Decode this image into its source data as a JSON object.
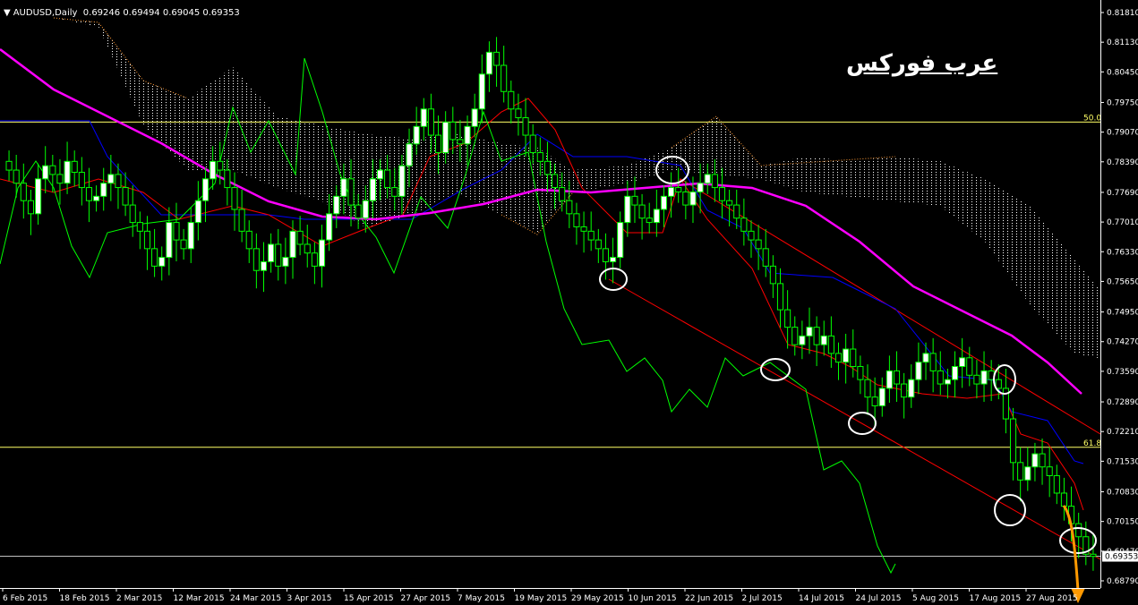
{
  "header": {
    "symbol": "AUDUSD,Daily",
    "ohlc": "0.69246 0.69494 0.69045 0.69353"
  },
  "logo_text": "عرب فوركس",
  "colors": {
    "background": "#000000",
    "bull_candle": "#ffffff",
    "candle_wick": "#00ff00",
    "tenkan": "#ff0000",
    "kijun": "#0000ff",
    "chikou": "#00ff00",
    "ma": "#ff00ff",
    "cloud": "#ffffff",
    "cloud_bear": "#ff9933",
    "fib_line": "#ffff66",
    "channel": "#ff0000",
    "circle": "#ffffff",
    "arrow": "#ff9900"
  },
  "chart_data": {
    "type": "candlestick",
    "title": "AUDUSD,Daily",
    "y_axis": {
      "min": 0.6879,
      "max": 0.8181,
      "ticks": [
        "0.81810",
        "0.81130",
        "0.80450",
        "0.79750",
        "0.79070",
        "0.78390",
        "0.77690",
        "0.77010",
        "0.76330",
        "0.75650",
        "0.74950",
        "0.74270",
        "0.73590",
        "0.72890",
        "0.72210",
        "0.71530",
        "0.70830",
        "0.70150",
        "0.69470",
        "0.68790"
      ]
    },
    "x_axis": {
      "labels": [
        "6 Feb 2015",
        "18 Feb 2015",
        "2 Mar 2015",
        "12 Mar 2015",
        "24 Mar 2015",
        "3 Apr 2015",
        "15 Apr 2015",
        "27 Apr 2015",
        "7 May 2015",
        "19 May 2015",
        "29 May 2015",
        "10 Jun 2015",
        "22 Jun 2015",
        "2 Jul 2015",
        "14 Jul 2015",
        "24 Jul 2015",
        "5 Aug 2015",
        "17 Aug 2015",
        "27 Aug 2015"
      ]
    },
    "fib_levels": [
      {
        "label": "50.0",
        "price": 0.793
      },
      {
        "label": "61.8",
        "price": 0.7185
      }
    ],
    "current_price": {
      "label": "0.69353",
      "value": 0.69353
    },
    "closes": [
      0.782,
      0.779,
      0.775,
      0.772,
      0.78,
      0.783,
      0.781,
      0.779,
      0.784,
      0.7815,
      0.778,
      0.775,
      0.776,
      0.779,
      0.781,
      0.778,
      0.774,
      0.77,
      0.768,
      0.764,
      0.76,
      0.762,
      0.77,
      0.766,
      0.764,
      0.77,
      0.775,
      0.78,
      0.784,
      0.782,
      0.778,
      0.773,
      0.768,
      0.764,
      0.759,
      0.761,
      0.765,
      0.76,
      0.762,
      0.768,
      0.765,
      0.763,
      0.76,
      0.766,
      0.772,
      0.776,
      0.78,
      0.774,
      0.771,
      0.775,
      0.78,
      0.782,
      0.778,
      0.776,
      0.783,
      0.788,
      0.792,
      0.796,
      0.79,
      0.786,
      0.793,
      0.789,
      0.788,
      0.792,
      0.796,
      0.804,
      0.809,
      0.806,
      0.8,
      0.796,
      0.794,
      0.79,
      0.786,
      0.784,
      0.781,
      0.778,
      0.775,
      0.772,
      0.769,
      0.768,
      0.766,
      0.764,
      0.761,
      0.762,
      0.77,
      0.776,
      0.774,
      0.771,
      0.77,
      0.773,
      0.776,
      0.778,
      0.777,
      0.774,
      0.777,
      0.779,
      0.781,
      0.778,
      0.775,
      0.774,
      0.771,
      0.768,
      0.766,
      0.764,
      0.76,
      0.756,
      0.75,
      0.746,
      0.742,
      0.744,
      0.746,
      0.742,
      0.744,
      0.74,
      0.738,
      0.741,
      0.737,
      0.734,
      0.73,
      0.728,
      0.732,
      0.736,
      0.733,
      0.73,
      0.734,
      0.738,
      0.74,
      0.736,
      0.733,
      0.734,
      0.737,
      0.739,
      0.735,
      0.733,
      0.736,
      0.734,
      0.732,
      0.725,
      0.715,
      0.711,
      0.714,
      0.717,
      0.714,
      0.712,
      0.708,
      0.705,
      0.701,
      0.698,
      0.694,
      0.6935
    ]
  }
}
